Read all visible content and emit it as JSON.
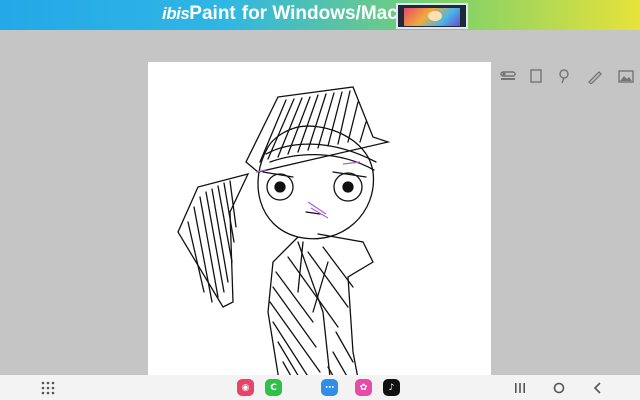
{
  "ad_banner": {
    "brand_ibis": "ibis",
    "brand_paint": "Paint",
    "tagline": "for Windows/Mac",
    "thumbnail_icon": "app-preview-image"
  },
  "canvas": {
    "background": "#ffffff",
    "stroke_color": "#111111",
    "accent_color": "#b05cd6"
  },
  "right_toolbar": [
    {
      "name": "layer-toggle-icon"
    },
    {
      "name": "selection-frame-icon"
    },
    {
      "name": "lasso-tool-icon"
    },
    {
      "name": "brush-icon"
    },
    {
      "name": "image-import-icon"
    }
  ],
  "bottom_toolbar": [
    {
      "name": "transform-icon"
    },
    {
      "name": "circle-icon"
    },
    {
      "name": "square-icon"
    },
    {
      "name": "redo-icon"
    },
    {
      "name": "layers-icon"
    },
    {
      "name": "back-icon"
    }
  ],
  "navbar": {
    "apps": [
      {
        "name": "camera-app-icon",
        "glyph": "◉",
        "color": "#e8436a"
      },
      {
        "name": "community-app-icon",
        "glyph": "C",
        "color": "#2fc04a"
      },
      {
        "name": "messages-app-icon",
        "glyph": "⋯",
        "color": "#2f8fe8"
      },
      {
        "name": "flower-app-icon",
        "glyph": "✿",
        "color": "#e84aa8"
      },
      {
        "name": "tiktok-app-icon",
        "glyph": "♪",
        "color": "#111111"
      }
    ],
    "buttons": [
      {
        "name": "app-drawer-icon"
      },
      {
        "name": "recents-icon"
      },
      {
        "name": "home-icon"
      },
      {
        "name": "back-nav-icon"
      }
    ]
  }
}
